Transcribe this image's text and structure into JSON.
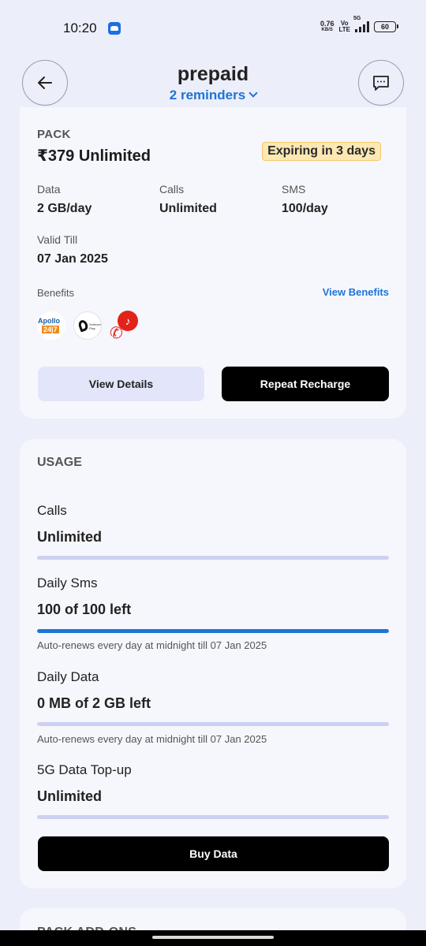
{
  "status_bar": {
    "time": "10:20",
    "net_speed_value": "0.76",
    "net_speed_unit": "KB/S",
    "volte_top": "Vo",
    "volte_bottom": "LTE",
    "network": "5G",
    "battery": "60"
  },
  "header": {
    "title": "prepaid",
    "subtitle": "2 reminders"
  },
  "pack": {
    "section_label": "PACK",
    "name": "₹379 Unlimited",
    "badge": "Expiring in 3 days",
    "data_label": "Data",
    "data_value": "2 GB/day",
    "calls_label": "Calls",
    "calls_value": "Unlimited",
    "sms_label": "SMS",
    "sms_value": "100/day",
    "valid_label": "Valid Till",
    "valid_value": "07 Jan 2025",
    "benefits_label": "Benefits",
    "view_benefits": "View Benefits",
    "benefit_apollo_top": "Apollo",
    "benefit_apollo_bottom": "24|7",
    "benefit_airtel_text": "Xstream Play",
    "benefit_music_glyph": "♪",
    "view_details_button": "View Details",
    "repeat_recharge_button": "Repeat Recharge"
  },
  "usage": {
    "title": "USAGE",
    "items": [
      {
        "label": "Calls",
        "value": "Unlimited",
        "used_fraction": 0.0
      },
      {
        "label": "Daily Sms",
        "value": "100 of 100 left",
        "used_fraction": 1.0,
        "note": "Auto-renews every day at midnight till 07 Jan 2025"
      },
      {
        "label": "Daily Data",
        "value": "0 MB of 2 GB left",
        "used_fraction": 0.0,
        "note": "Auto-renews every day at midnight till 07 Jan 2025"
      },
      {
        "label": "5G Data Top-up",
        "value": "Unlimited",
        "used_fraction": 0.0
      }
    ],
    "buy_data_button": "Buy Data"
  },
  "next_section": {
    "title": "PACK ADD-ONS"
  },
  "colors": {
    "accent": "#1e74d6",
    "badge_bg": "#fde8b4",
    "primary_button": "#000000",
    "background": "#eceef9"
  }
}
